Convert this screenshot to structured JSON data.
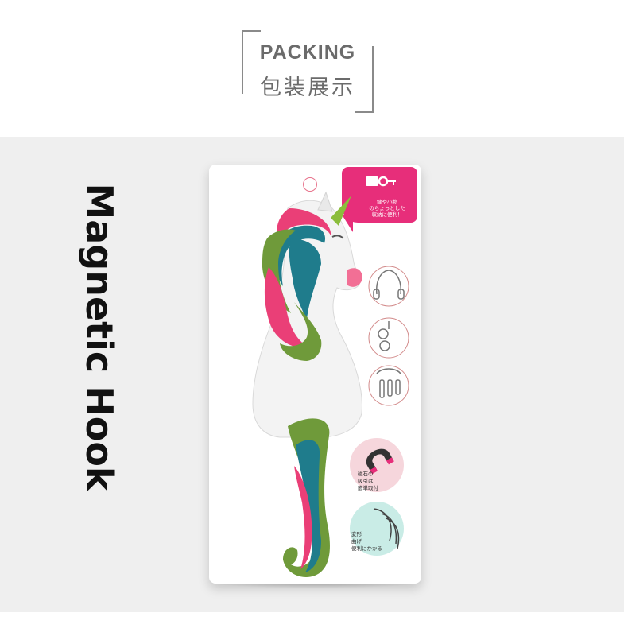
{
  "header": {
    "title": "PACKING",
    "subtitle": "包装展示"
  },
  "package": {
    "product_title": "Magnetic Hook",
    "bubble_text": "鍵や小物\nのちょっとした\n収納に便利！",
    "feature_magnet_text": "磁石の\n吸引は\n簡単取付",
    "feature_bend_text": "変形\n曲げ\n便利にかかる"
  },
  "colors": {
    "header_text": "#6b6b6b",
    "stage_background": "#efefef",
    "bubble_pink": "#e72e7a",
    "mane_pink": "#ea3f77",
    "mane_green": "#6f9a3a",
    "mane_teal": "#1f7c8c",
    "body_white": "#f3f3f3",
    "horn_green": "#8bbd3c",
    "magnet_circle": "#f6d6dc",
    "bend_circle": "#c9ece6"
  },
  "icons": [
    "key-icon",
    "headphones-icon",
    "glasses-icon",
    "keys-icon",
    "magnet-icon",
    "bend-hook-icon"
  ]
}
